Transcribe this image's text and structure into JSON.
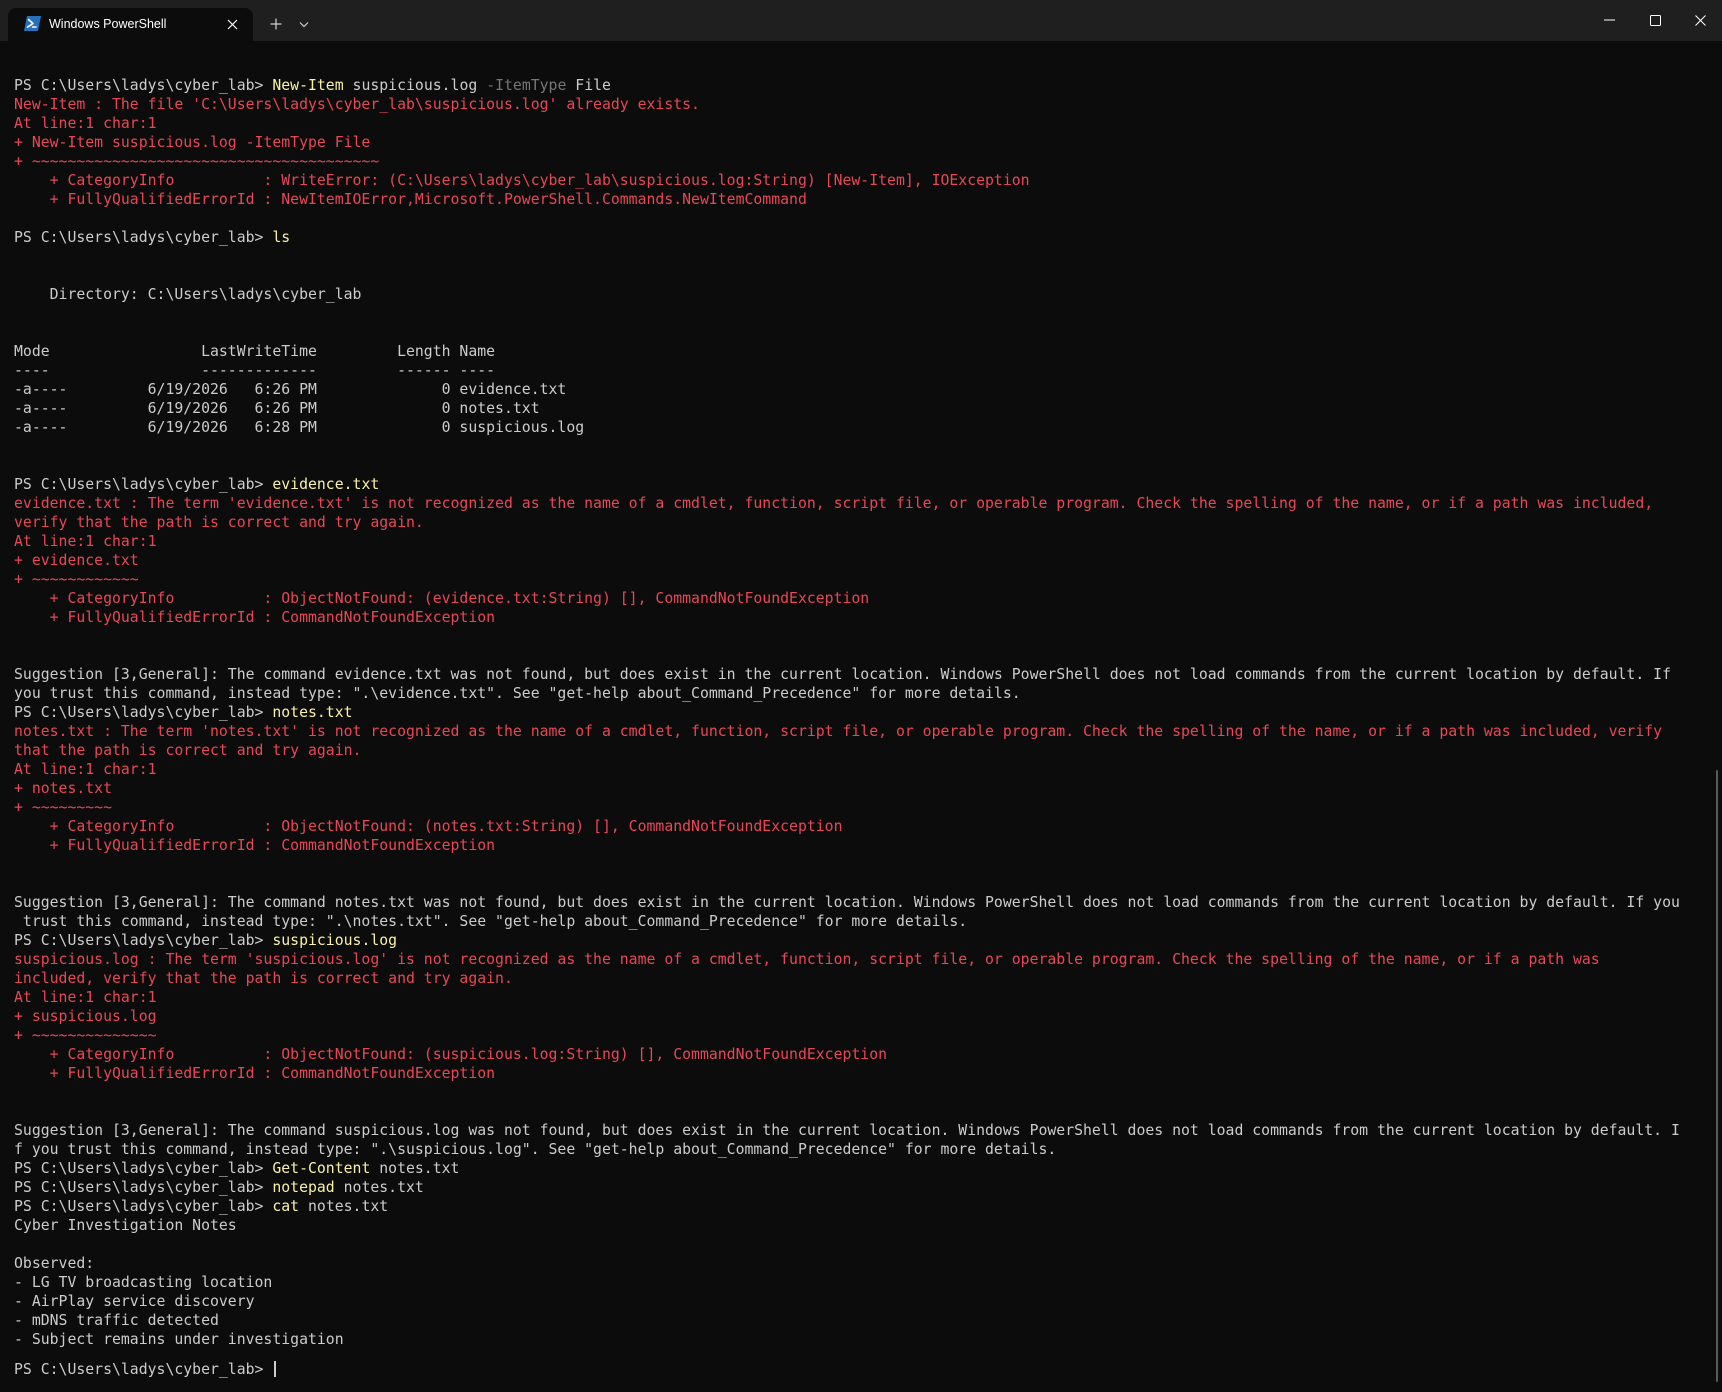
{
  "window": {
    "tab_title": "Windows PowerShell",
    "tab_icon": "powershell-icon",
    "new_tab_icon": "plus-icon",
    "dropdown_icon": "chevron-down-icon",
    "close_tab_icon": "close-icon",
    "minimize_icon": "minimize-icon",
    "maximize_icon": "maximize-icon",
    "close_window_icon": "close-icon"
  },
  "colors": {
    "background": "#0c0c0c",
    "titlebar": "#1f1f1f",
    "text": "#cccccc",
    "error": "#e74856",
    "command": "#f9f1a5",
    "parameter": "#767676"
  },
  "terminal": {
    "prompt": "PS C:\\Users\\ladys\\cyber_lab> ",
    "lines": [
      {
        "segs": [
          {
            "t": "PS C:\\Users\\ladys\\cyber_lab> "
          },
          {
            "t": "New-Item",
            "c": "cmd"
          },
          {
            "t": " suspicious.log "
          },
          {
            "t": "-ItemType",
            "c": "par"
          },
          {
            "t": " File"
          }
        ]
      },
      {
        "segs": [
          {
            "t": "New-Item : The file 'C:\\Users\\ladys\\cyber_lab\\suspicious.log' already exists.",
            "c": "err"
          }
        ]
      },
      {
        "segs": [
          {
            "t": "At line:1 char:1",
            "c": "err"
          }
        ]
      },
      {
        "segs": [
          {
            "t": "+ New-Item suspicious.log -ItemType File",
            "c": "err"
          }
        ]
      },
      {
        "segs": [
          {
            "t": "+ ~~~~~~~~~~~~~~~~~~~~~~~~~~~~~~~~~~~~~~~",
            "c": "err"
          }
        ]
      },
      {
        "segs": [
          {
            "t": "    + CategoryInfo          : WriteError: (C:\\Users\\ladys\\cyber_lab\\suspicious.log:String) [New-Item], IOException",
            "c": "err"
          }
        ]
      },
      {
        "segs": [
          {
            "t": "    + FullyQualifiedErrorId : NewItemIOError,Microsoft.PowerShell.Commands.NewItemCommand",
            "c": "err"
          }
        ]
      },
      {
        "segs": [
          {
            "t": ""
          }
        ]
      },
      {
        "segs": [
          {
            "t": "PS C:\\Users\\ladys\\cyber_lab> "
          },
          {
            "t": "ls",
            "c": "cmd"
          }
        ]
      },
      {
        "segs": [
          {
            "t": ""
          }
        ]
      },
      {
        "segs": [
          {
            "t": ""
          }
        ]
      },
      {
        "segs": [
          {
            "t": "    Directory: C:\\Users\\ladys\\cyber_lab"
          }
        ]
      },
      {
        "segs": [
          {
            "t": ""
          }
        ]
      },
      {
        "segs": [
          {
            "t": ""
          }
        ]
      },
      {
        "segs": [
          {
            "t": "Mode                 LastWriteTime         Length Name"
          }
        ]
      },
      {
        "segs": [
          {
            "t": "----                 -------------         ------ ----"
          }
        ]
      },
      {
        "segs": [
          {
            "t": "-a----         6/19/2026   6:26 PM              0 evidence.txt"
          }
        ]
      },
      {
        "segs": [
          {
            "t": "-a----         6/19/2026   6:26 PM              0 notes.txt"
          }
        ]
      },
      {
        "segs": [
          {
            "t": "-a----         6/19/2026   6:28 PM              0 suspicious.log"
          }
        ]
      },
      {
        "segs": [
          {
            "t": ""
          }
        ]
      },
      {
        "segs": [
          {
            "t": ""
          }
        ]
      },
      {
        "segs": [
          {
            "t": "PS C:\\Users\\ladys\\cyber_lab> "
          },
          {
            "t": "evidence.txt",
            "c": "cmd"
          }
        ]
      },
      {
        "segs": [
          {
            "t": "evidence.txt : The term 'evidence.txt' is not recognized as the name of a cmdlet, function, script file, or operable program. Check the spelling of the name, or if a path was included,",
            "c": "err"
          }
        ]
      },
      {
        "segs": [
          {
            "t": "verify that the path is correct and try again.",
            "c": "err"
          }
        ]
      },
      {
        "segs": [
          {
            "t": "At line:1 char:1",
            "c": "err"
          }
        ]
      },
      {
        "segs": [
          {
            "t": "+ evidence.txt",
            "c": "err"
          }
        ]
      },
      {
        "segs": [
          {
            "t": "+ ~~~~~~~~~~~~",
            "c": "err"
          }
        ]
      },
      {
        "segs": [
          {
            "t": "    + CategoryInfo          : ObjectNotFound: (evidence.txt:String) [], CommandNotFoundException",
            "c": "err"
          }
        ]
      },
      {
        "segs": [
          {
            "t": "    + FullyQualifiedErrorId : CommandNotFoundException",
            "c": "err"
          }
        ]
      },
      {
        "segs": [
          {
            "t": ""
          }
        ]
      },
      {
        "segs": [
          {
            "t": ""
          }
        ]
      },
      {
        "segs": [
          {
            "t": "Suggestion [3,General]: The command evidence.txt was not found, but does exist in the current location. Windows PowerShell does not load commands from the current location by default. If"
          }
        ]
      },
      {
        "segs": [
          {
            "t": "you trust this command, instead type: \".\\evidence.txt\". See \"get-help about_Command_Precedence\" for more details."
          }
        ]
      },
      {
        "segs": [
          {
            "t": "PS C:\\Users\\ladys\\cyber_lab> "
          },
          {
            "t": "notes.txt",
            "c": "cmd"
          }
        ]
      },
      {
        "segs": [
          {
            "t": "notes.txt : The term 'notes.txt' is not recognized as the name of a cmdlet, function, script file, or operable program. Check the spelling of the name, or if a path was included, verify",
            "c": "err"
          }
        ]
      },
      {
        "segs": [
          {
            "t": "that the path is correct and try again.",
            "c": "err"
          }
        ]
      },
      {
        "segs": [
          {
            "t": "At line:1 char:1",
            "c": "err"
          }
        ]
      },
      {
        "segs": [
          {
            "t": "+ notes.txt",
            "c": "err"
          }
        ]
      },
      {
        "segs": [
          {
            "t": "+ ~~~~~~~~~",
            "c": "err"
          }
        ]
      },
      {
        "segs": [
          {
            "t": "    + CategoryInfo          : ObjectNotFound: (notes.txt:String) [], CommandNotFoundException",
            "c": "err"
          }
        ]
      },
      {
        "segs": [
          {
            "t": "    + FullyQualifiedErrorId : CommandNotFoundException",
            "c": "err"
          }
        ]
      },
      {
        "segs": [
          {
            "t": ""
          }
        ]
      },
      {
        "segs": [
          {
            "t": ""
          }
        ]
      },
      {
        "segs": [
          {
            "t": "Suggestion [3,General]: The command notes.txt was not found, but does exist in the current location. Windows PowerShell does not load commands from the current location by default. If you"
          }
        ]
      },
      {
        "segs": [
          {
            "t": " trust this command, instead type: \".\\notes.txt\". See \"get-help about_Command_Precedence\" for more details."
          }
        ]
      },
      {
        "segs": [
          {
            "t": "PS C:\\Users\\ladys\\cyber_lab> "
          },
          {
            "t": "suspicious.log",
            "c": "cmd"
          }
        ]
      },
      {
        "segs": [
          {
            "t": "suspicious.log : The term 'suspicious.log' is not recognized as the name of a cmdlet, function, script file, or operable program. Check the spelling of the name, or if a path was",
            "c": "err"
          }
        ]
      },
      {
        "segs": [
          {
            "t": "included, verify that the path is correct and try again.",
            "c": "err"
          }
        ]
      },
      {
        "segs": [
          {
            "t": "At line:1 char:1",
            "c": "err"
          }
        ]
      },
      {
        "segs": [
          {
            "t": "+ suspicious.log",
            "c": "err"
          }
        ]
      },
      {
        "segs": [
          {
            "t": "+ ~~~~~~~~~~~~~~",
            "c": "err"
          }
        ]
      },
      {
        "segs": [
          {
            "t": "    + CategoryInfo          : ObjectNotFound: (suspicious.log:String) [], CommandNotFoundException",
            "c": "err"
          }
        ]
      },
      {
        "segs": [
          {
            "t": "    + FullyQualifiedErrorId : CommandNotFoundException",
            "c": "err"
          }
        ]
      },
      {
        "segs": [
          {
            "t": ""
          }
        ]
      },
      {
        "segs": [
          {
            "t": ""
          }
        ]
      },
      {
        "segs": [
          {
            "t": "Suggestion [3,General]: The command suspicious.log was not found, but does exist in the current location. Windows PowerShell does not load commands from the current location by default. I"
          }
        ]
      },
      {
        "segs": [
          {
            "t": "f you trust this command, instead type: \".\\suspicious.log\". See \"get-help about_Command_Precedence\" for more details."
          }
        ]
      },
      {
        "segs": [
          {
            "t": "PS C:\\Users\\ladys\\cyber_lab> "
          },
          {
            "t": "Get-Content",
            "c": "cmd"
          },
          {
            "t": " notes.txt"
          }
        ]
      },
      {
        "segs": [
          {
            "t": "PS C:\\Users\\ladys\\cyber_lab> "
          },
          {
            "t": "notepad",
            "c": "cmd"
          },
          {
            "t": " notes.txt"
          }
        ]
      },
      {
        "segs": [
          {
            "t": "PS C:\\Users\\ladys\\cyber_lab> "
          },
          {
            "t": "cat",
            "c": "cmd"
          },
          {
            "t": " notes.txt"
          }
        ]
      },
      {
        "segs": [
          {
            "t": "Cyber Investigation Notes"
          }
        ]
      },
      {
        "segs": [
          {
            "t": ""
          }
        ]
      },
      {
        "segs": [
          {
            "t": "Observed:"
          }
        ]
      },
      {
        "segs": [
          {
            "t": "- LG TV broadcasting location"
          }
        ]
      },
      {
        "segs": [
          {
            "t": "- AirPlay service discovery"
          }
        ]
      },
      {
        "segs": [
          {
            "t": "- mDNS traffic detected"
          }
        ]
      },
      {
        "segs": [
          {
            "t": "- Subject remains under investigation"
          }
        ]
      }
    ]
  }
}
